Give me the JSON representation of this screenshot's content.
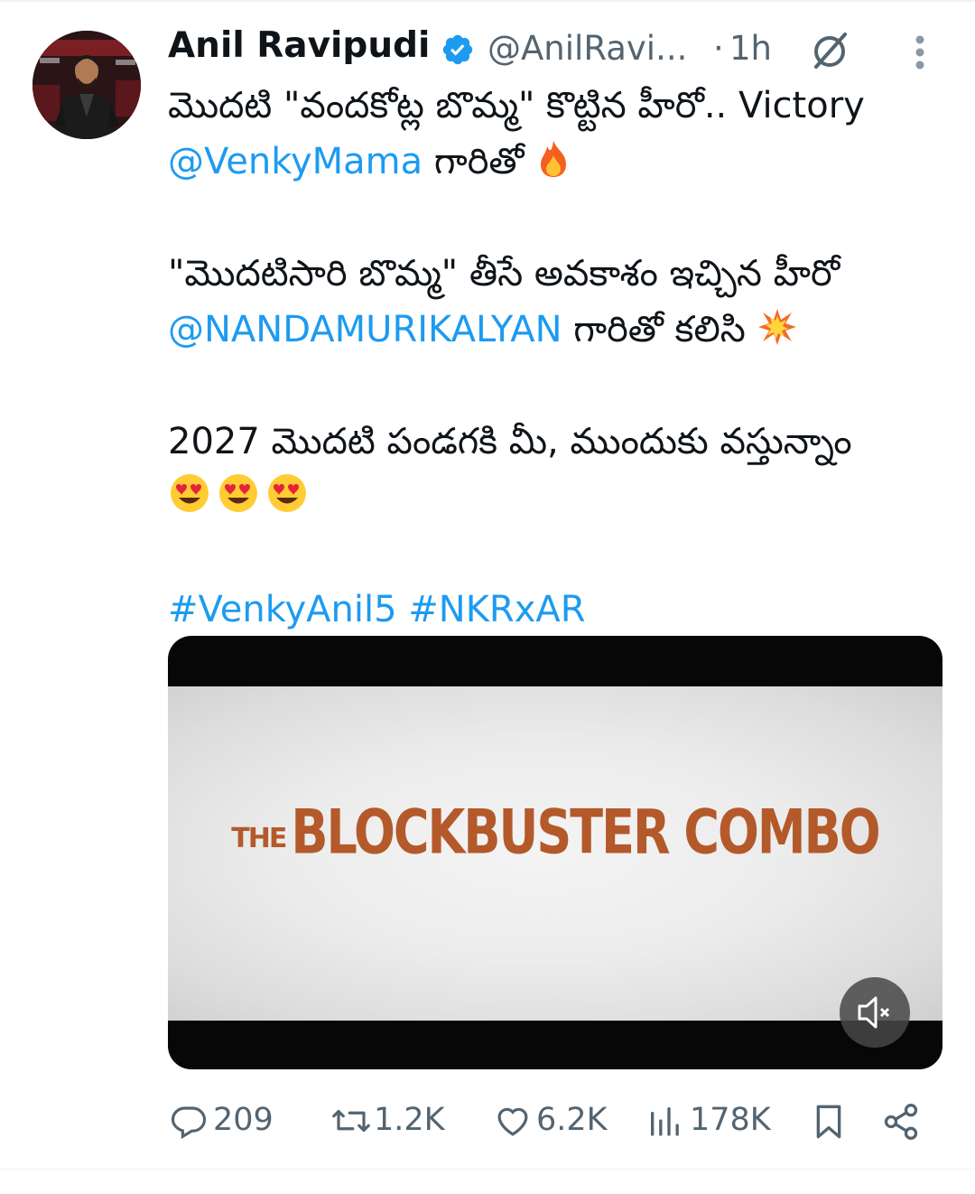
{
  "author": {
    "display_name": "Anil Ravipudi",
    "handle": "@AnilRavi...",
    "verified": true,
    "time_separator": "·",
    "timestamp": "1h"
  },
  "tweet": {
    "line1_text": "మొదటి \"వందకోట్ల బొమ్మ\" కొట్టిన హీరో.. Victory",
    "line2_mention": "@VenkyMama",
    "line2_text": " గారితో",
    "line3_text": "\"మొదటిసారి బొమ్మ\" తీసే అవకాశం ఇచ్చిన హీరో",
    "line4_mention": "@NANDAMURIKALYAN",
    "line4_text": " గారితో కలిసి ",
    "line5_text": "2027 మొదటి పండగకి మీ, ముందుకు వస్తున్నాం",
    "hashtag1": "#VenkyAnil5",
    "hashtag2": "#NKRxAR"
  },
  "media": {
    "title_small": "THE",
    "title_big": "BLOCKBUSTER COMBO",
    "title_color": "#b4592a",
    "muted": true
  },
  "metrics": {
    "replies": "209",
    "reposts": "1.2K",
    "likes": "6.2K",
    "views": "178K"
  },
  "colors": {
    "link": "#1d9bf0",
    "secondary_text": "#536471",
    "primary_text": "#0f1419"
  },
  "icons": {
    "verified": "verified-badge-icon",
    "grok": "grok-icon",
    "more": "more-vertical-icon",
    "reply": "reply-icon",
    "repost": "repost-icon",
    "like": "heart-icon",
    "views": "views-icon",
    "bookmark": "bookmark-icon",
    "share": "share-icon",
    "mute": "mute-icon",
    "fire": "fire-emoji",
    "collision": "collision-emoji",
    "heart_eyes": "heart-eyes-emoji"
  }
}
